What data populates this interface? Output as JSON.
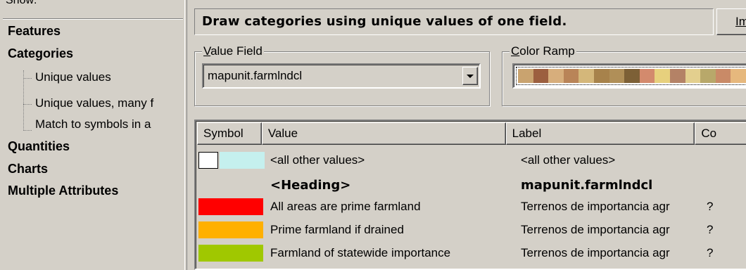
{
  "left_panel": {
    "show_label": "Show:",
    "items": [
      {
        "label": "Features",
        "type": "category"
      },
      {
        "label": "Categories",
        "type": "category"
      },
      {
        "label": "Unique values",
        "type": "child"
      },
      {
        "label": "Unique values, many f",
        "type": "child"
      },
      {
        "label": "Match to symbols in a",
        "type": "child"
      },
      {
        "label": "Quantities",
        "type": "category"
      },
      {
        "label": "Charts",
        "type": "category"
      },
      {
        "label": "Multiple Attributes",
        "type": "category"
      }
    ]
  },
  "header": {
    "description": "Draw categories using unique values of one field.",
    "import_button": "Im"
  },
  "value_field": {
    "legend": "Value Field",
    "legend_accel": "V",
    "legend_rest": "alue Field",
    "selected": "mapunit.farmlndcl"
  },
  "color_ramp": {
    "legend": "Color Ramp",
    "legend_accel": "C",
    "legend_rest": "olor Ramp",
    "colors": [
      "#c9a36f",
      "#9c5f3f",
      "#d7ae7c",
      "#b98458",
      "#d4b77a",
      "#a7824b",
      "#b08f58",
      "#7d6036",
      "#d38a6d",
      "#e7d07d",
      "#b48266",
      "#e3cf8e",
      "#b8a86a",
      "#c98a67",
      "#e6b87d"
    ]
  },
  "table": {
    "columns": [
      "Symbol",
      "Value",
      "Label",
      "Co"
    ],
    "rows": [
      {
        "symbol": "other",
        "value": "<all other values>",
        "label": "<all other values>",
        "count": "",
        "bold": false
      },
      {
        "symbol": "none",
        "value": "<Heading>",
        "label": "mapunit.farmlndcl",
        "count": "",
        "bold": true
      },
      {
        "symbol": "#ff0000",
        "value": "All areas are prime farmland",
        "label": "Terrenos de importancia agr",
        "count": "?",
        "bold": false
      },
      {
        "symbol": "#ffb000",
        "value": "Prime farmland if drained",
        "label": "Terrenos de importancia agr",
        "count": "?",
        "bold": false
      },
      {
        "symbol": "#a0c800",
        "value": "Farmland of statewide importance",
        "label": "Terrenos de importancia agr",
        "count": "?",
        "bold": false
      }
    ]
  }
}
